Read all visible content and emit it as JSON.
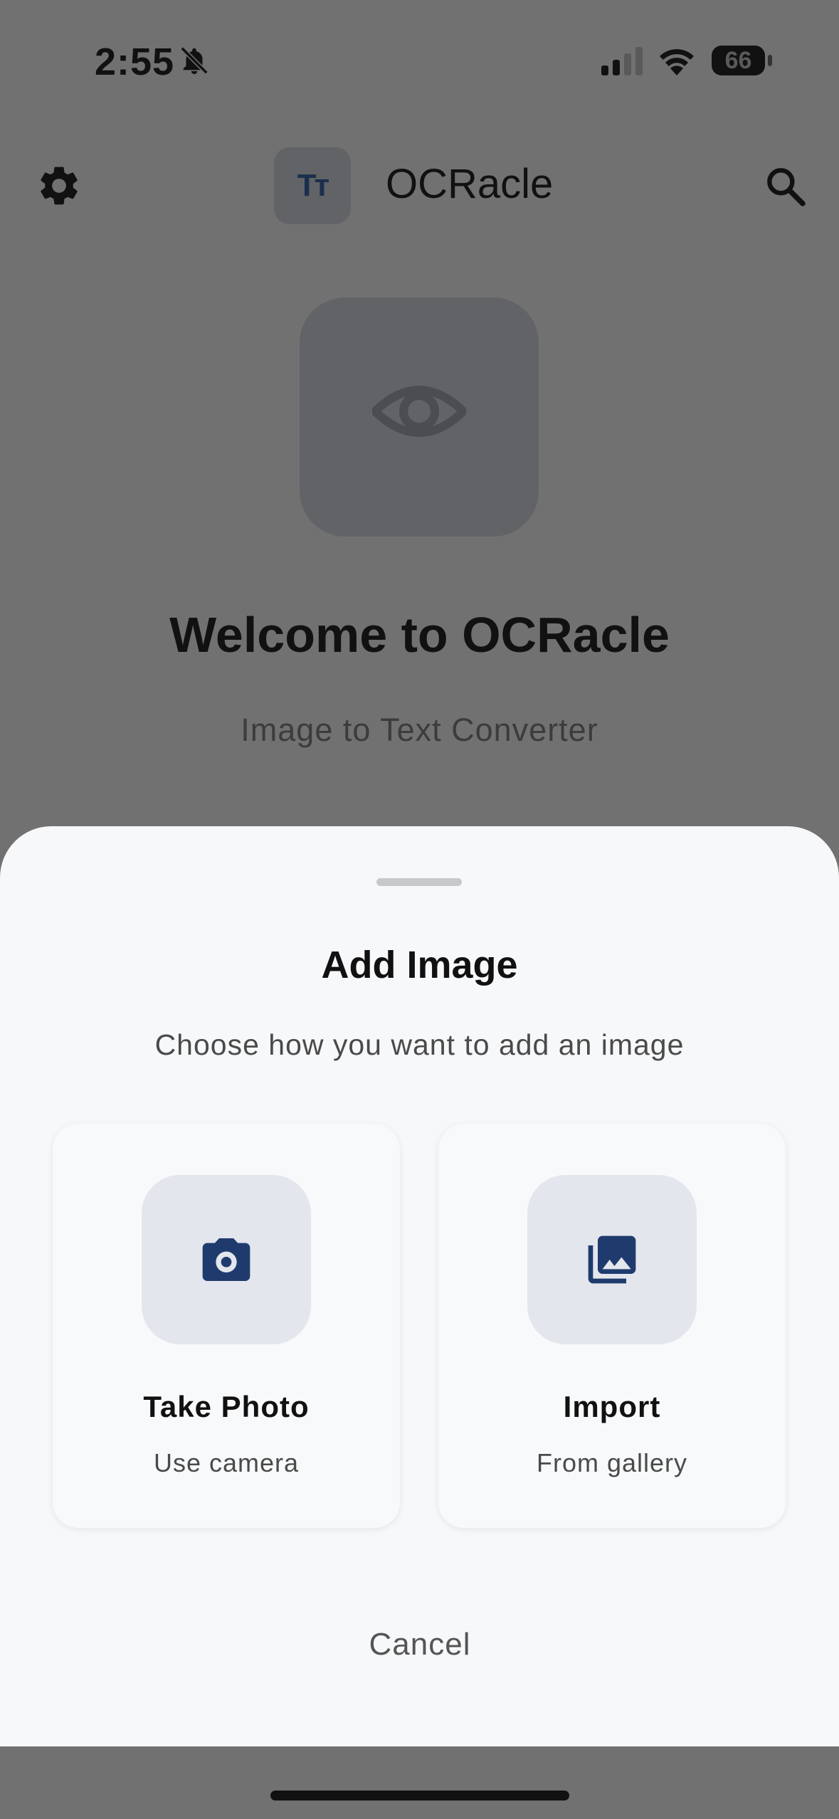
{
  "status_bar": {
    "time": "2:55",
    "battery_level": "66",
    "icons": [
      "bell-slash-icon",
      "cellular-signal-icon",
      "wifi-icon",
      "battery-icon"
    ]
  },
  "app_bar": {
    "logo_text": "Tт",
    "title": "OCRacle",
    "icons": [
      "gear-icon",
      "search-icon"
    ]
  },
  "hero": {
    "icon": "eye-icon",
    "title": "Welcome to OCRacle",
    "subtitle": "Image to Text Converter"
  },
  "sheet": {
    "title": "Add Image",
    "subtitle": "Choose how you want to add an image",
    "options": [
      {
        "icon": "camera-icon",
        "title": "Take Photo",
        "subtitle": "Use camera"
      },
      {
        "icon": "photo-library-icon",
        "title": "Import",
        "subtitle": "From gallery"
      }
    ],
    "cancel_label": "Cancel"
  },
  "colors": {
    "overlay": "#717171",
    "sheet_background": "#f7f8fa",
    "icon_tile": "#e3e6ec",
    "accent_navy": "#1f3b6e"
  }
}
